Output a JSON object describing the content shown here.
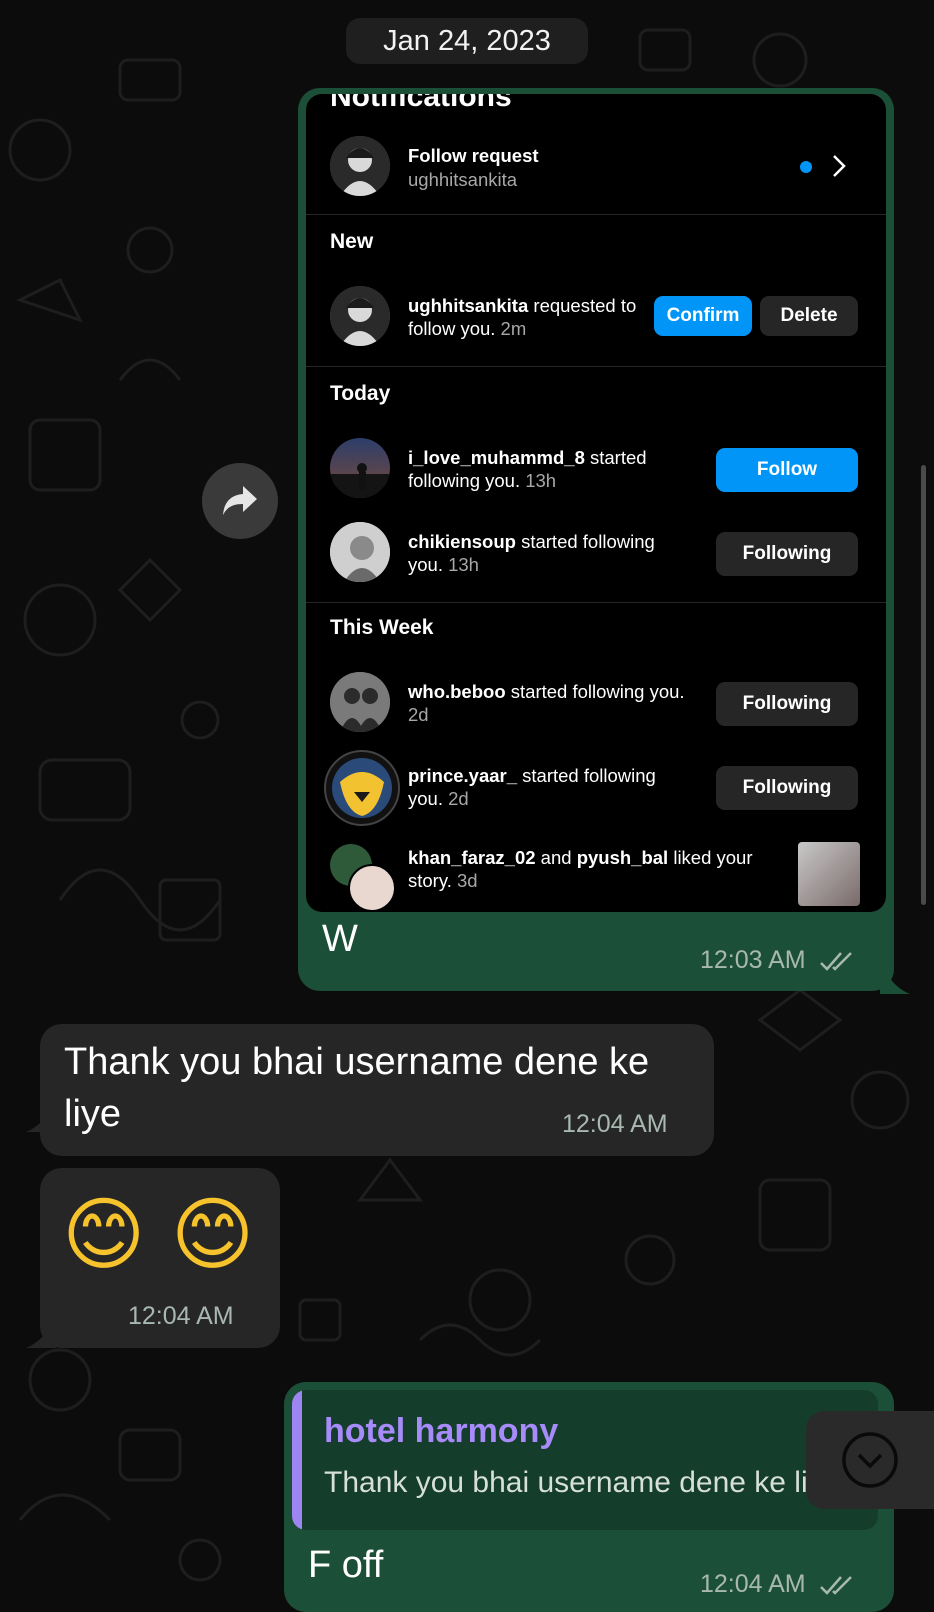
{
  "date_chip": "Jan 24, 2023",
  "screenshot": {
    "cut_title": "Notifications",
    "follow_request": {
      "title": "Follow request",
      "username": "ughhitsankita"
    },
    "sections": {
      "new": "New",
      "today": "Today",
      "this_week": "This Week"
    },
    "items": [
      {
        "username": "ughhitsankita",
        "action": " requested to follow you.",
        "time": " 2m",
        "buttons": [
          "Confirm",
          "Delete"
        ]
      },
      {
        "username": "i_love_muhammd_8",
        "action": " started following you.",
        "time": " 13h",
        "button": "Follow"
      },
      {
        "username": "chikiensoup",
        "action": " started following you.",
        "time": " 13h",
        "button": "Following"
      },
      {
        "username": "who.beboo",
        "action": " started following you.",
        "time": " 2d",
        "button": "Following"
      },
      {
        "username": "prince.yaar_",
        "action": " started following you.",
        "time": " 2d",
        "button": "Following"
      },
      {
        "username": "khan_faraz_02",
        "and": " and ",
        "username2": "pyush_bal",
        "action": " liked your story.",
        "time": " 3d"
      }
    ]
  },
  "messages": [
    {
      "direction": "out",
      "text": "W",
      "time": "12:03 AM",
      "read": true
    },
    {
      "direction": "in",
      "text": "Thank you bhai username dene ke liye",
      "time": "12:04 AM"
    },
    {
      "direction": "in",
      "text": "😊 😊",
      "time": "12:04 AM"
    },
    {
      "direction": "out",
      "reply_to_name": "hotel harmony",
      "reply_to_text": "Thank you bhai username dene ke liye",
      "text": "F off",
      "time": "12:04 AM",
      "read": true
    }
  ],
  "colors": {
    "out_bubble": "#1c4f37",
    "in_bubble": "#262626",
    "accent_blue": "#0095f6",
    "reply_name": "#a78bfa",
    "reply_bar": "#9d86f2"
  },
  "icons": {
    "forward": "share-forward-icon",
    "scroll": "chevron-down-icon",
    "ticks": "double-check-icon"
  }
}
